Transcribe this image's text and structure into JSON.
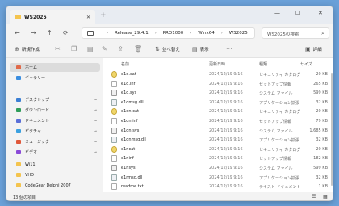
{
  "window": {
    "tab_title": "WS2025",
    "tab_close": "✕",
    "new_tab": "+",
    "minimize": "—",
    "maximize": "☐",
    "close": "✕"
  },
  "nav": {
    "back": "←",
    "forward": "→",
    "up": "↑",
    "refresh": "⟳"
  },
  "address": {
    "crumbs": [
      "Release_29.4.1",
      "PRO1000",
      "Winx64",
      "WS2025"
    ],
    "separator": "›",
    "search_placeholder": "WS2025の検索",
    "search_icon": "⌕"
  },
  "toolbar": {
    "new_label": "新規作成",
    "sort_label": "並べ替え",
    "view_label": "表示",
    "more": "···",
    "details_label": "詳細",
    "icons": [
      "cut-icon",
      "copy-icon",
      "paste-icon",
      "rename-icon",
      "share-icon",
      "delete-icon"
    ]
  },
  "sidebar": {
    "items": [
      {
        "label": "ホーム",
        "color": "#e06a4a",
        "pinned": false
      },
      {
        "label": "ギャラリー",
        "color": "#3b8ee0",
        "pinned": false
      },
      {
        "label": "デスクトップ",
        "color": "#3b7fd4",
        "pinned": true
      },
      {
        "label": "ダウンロード",
        "color": "#2f9e5a",
        "pinned": true
      },
      {
        "label": "ドキュメント",
        "color": "#5a6fd8",
        "pinned": true
      },
      {
        "label": "ピクチャ",
        "color": "#3aa0e0",
        "pinned": true
      },
      {
        "label": "ミュージック",
        "color": "#e0583a",
        "pinned": true
      },
      {
        "label": "ビデオ",
        "color": "#8a4ad8",
        "pinned": true
      },
      {
        "label": "Wi11",
        "color": "#f4c44e",
        "pinned": false
      },
      {
        "label": "VHD",
        "color": "#f4c44e",
        "pinned": false
      },
      {
        "label": "CodeGear Delphi 2007",
        "color": "#f4c44e",
        "pinned": false
      }
    ],
    "pin_glyph": "📌"
  },
  "list": {
    "headers": {
      "name": "名前",
      "date": "更新日時",
      "type": "種類",
      "size": "サイズ"
    },
    "rows": [
      {
        "name": "e1d.cat",
        "date": "2024/12/19 9:16",
        "type": "セキュリティ カタログ",
        "size": "20 KB",
        "kind": "cat"
      },
      {
        "name": "e1d.inf",
        "date": "2024/12/19 9:16",
        "type": "セットアップ情報",
        "size": "265 KB",
        "kind": "inf"
      },
      {
        "name": "e1d.sys",
        "date": "2024/12/19 9:16",
        "type": "システム ファイル",
        "size": "599 KB",
        "kind": "sys"
      },
      {
        "name": "e1dmsg.dll",
        "date": "2024/12/19 9:16",
        "type": "アプリケーション拡張",
        "size": "32 KB",
        "kind": "dll"
      },
      {
        "name": "e1dn.cat",
        "date": "2024/12/19 9:16",
        "type": "セキュリティ カタログ",
        "size": "20 KB",
        "kind": "cat"
      },
      {
        "name": "e1dn.inf",
        "date": "2024/12/19 9:16",
        "type": "セットアップ情報",
        "size": "79 KB",
        "kind": "inf"
      },
      {
        "name": "e1dn.sys",
        "date": "2024/12/19 9:16",
        "type": "システム ファイル",
        "size": "1,685 KB",
        "kind": "sys"
      },
      {
        "name": "e1dnmsg.dll",
        "date": "2024/12/19 9:16",
        "type": "アプリケーション拡張",
        "size": "32 KB",
        "kind": "dll"
      },
      {
        "name": "e1r.cat",
        "date": "2024/12/19 9:16",
        "type": "セキュリティ カタログ",
        "size": "20 KB",
        "kind": "cat"
      },
      {
        "name": "e1r.inf",
        "date": "2024/12/19 9:16",
        "type": "セットアップ情報",
        "size": "182 KB",
        "kind": "inf"
      },
      {
        "name": "e1r.sys",
        "date": "2024/12/19 9:16",
        "type": "システム ファイル",
        "size": "599 KB",
        "kind": "sys"
      },
      {
        "name": "e1rmsg.dll",
        "date": "2024/12/19 9:16",
        "type": "アプリケーション拡張",
        "size": "32 KB",
        "kind": "dll"
      },
      {
        "name": "readme.txt",
        "date": "2024/12/19 9:16",
        "type": "テキスト ドキュメント",
        "size": "1 KB",
        "kind": "txt"
      }
    ]
  },
  "status": {
    "count": "13 個の項目",
    "details_view": "☰",
    "tiles_view": "▦"
  }
}
